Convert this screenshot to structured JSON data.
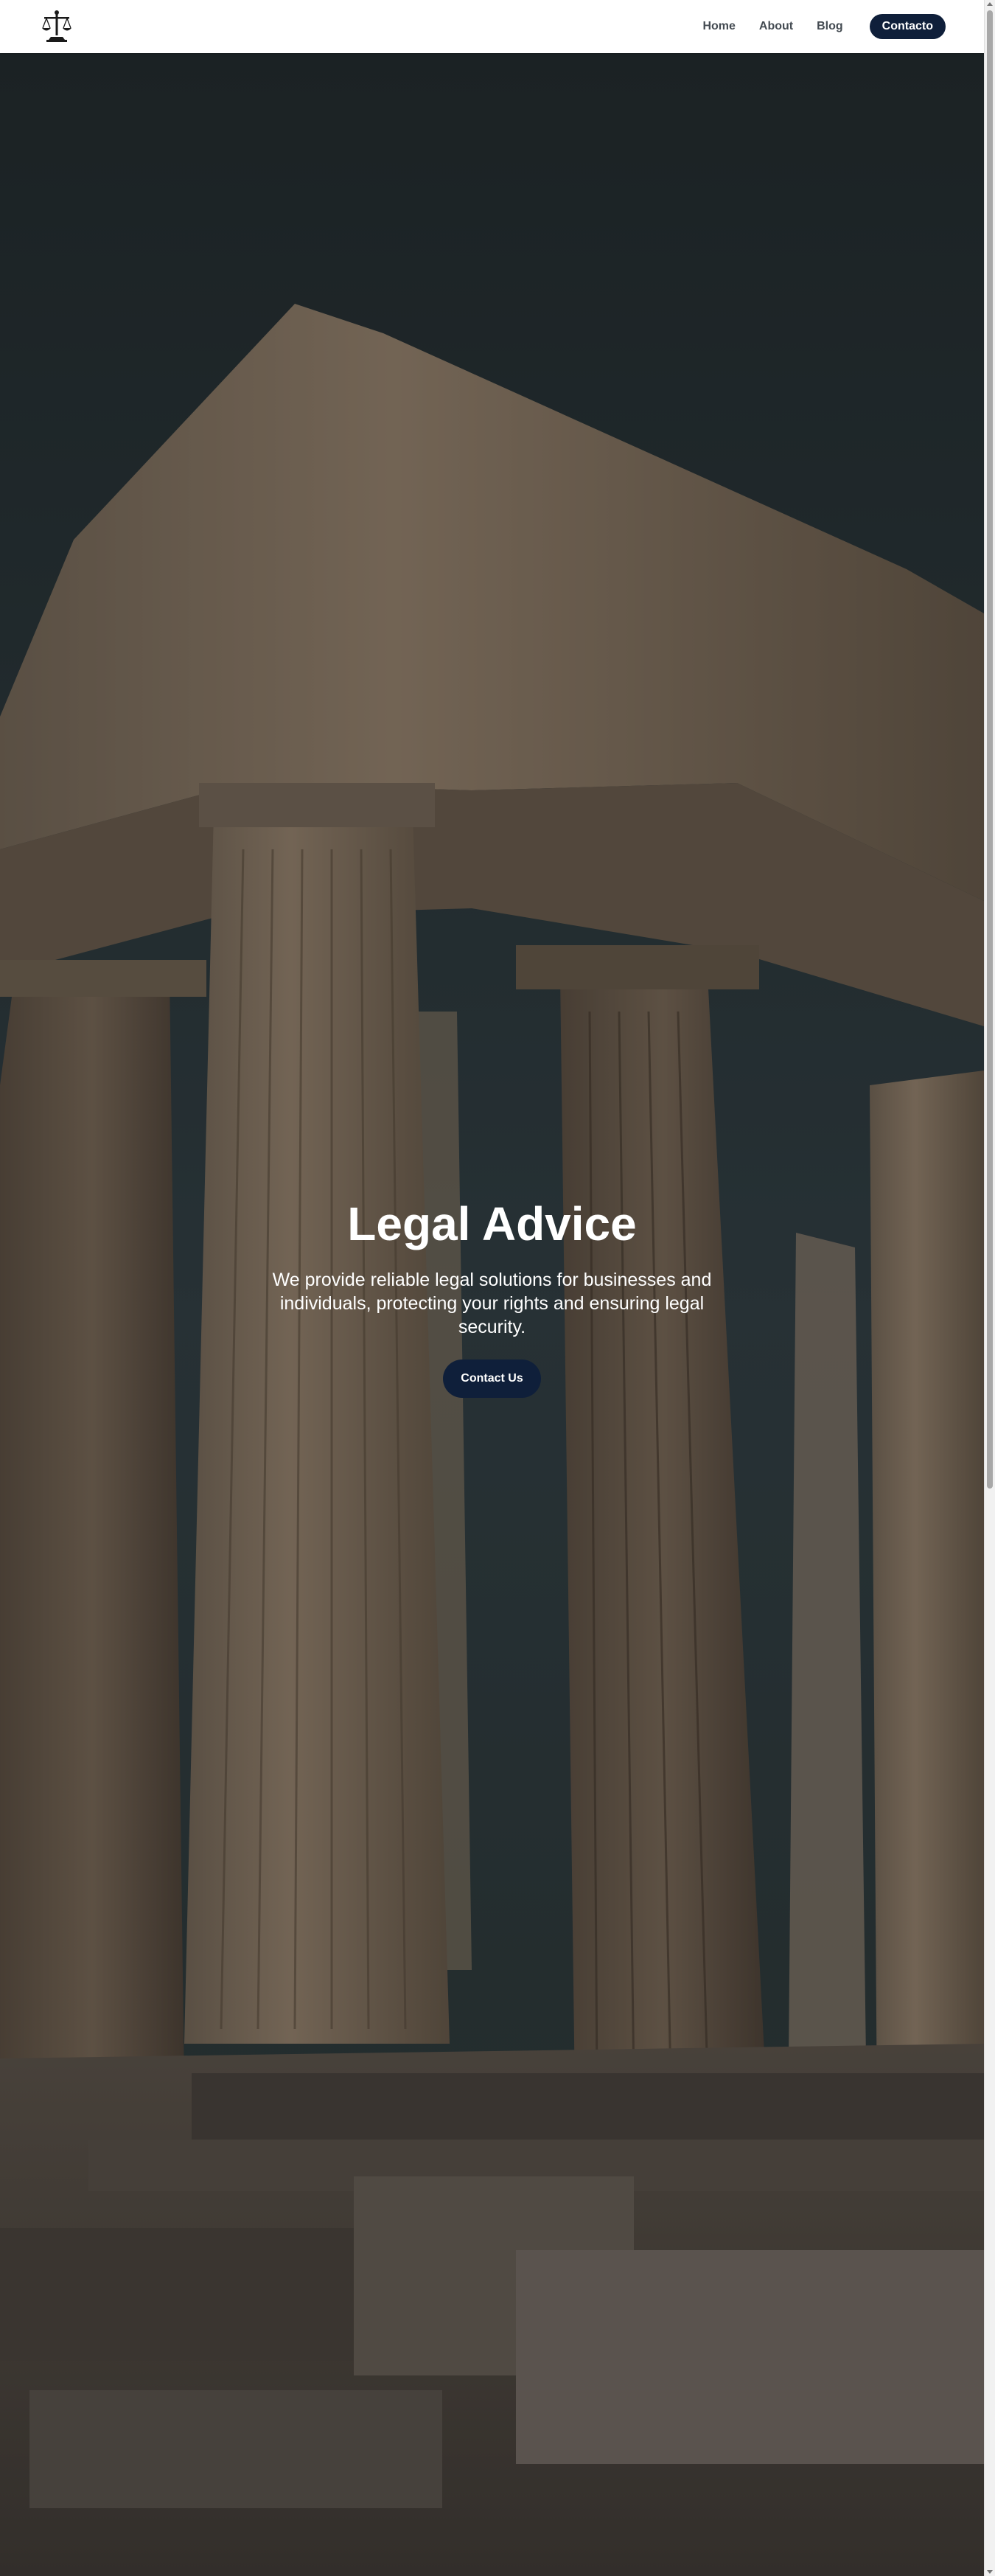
{
  "header": {
    "logo_icon": "scales-of-justice-icon",
    "nav": [
      {
        "label": "Home"
      },
      {
        "label": "About"
      },
      {
        "label": "Blog"
      }
    ],
    "cta_label": "Contacto"
  },
  "hero": {
    "title": "Legal Advice",
    "subtitle": "We provide reliable legal solutions for businesses and individuals, protecting your rights and ensuring legal security.",
    "button_label": "Contact Us",
    "background_image": "ancient-greek-temple-columns"
  },
  "colors": {
    "brand_navy": "#0f1f3a",
    "nav_text": "#444b52",
    "header_bg": "#ffffff"
  }
}
